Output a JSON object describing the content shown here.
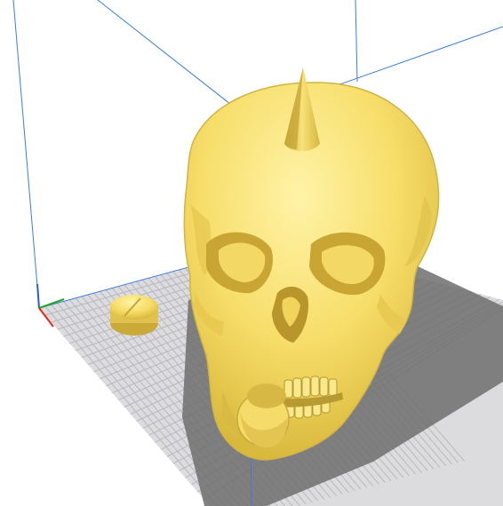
{
  "viewport": {
    "scene": "3d-build-volume-viewport",
    "background": "#ffffff",
    "grid_plate_color": "#dcdcde",
    "grid_line_color": "#b8b8be",
    "build_volume_edge_color": "#3b7fd6",
    "model_color": "#f7de6a",
    "model_shadow_color": "#7a7a7a"
  },
  "axes": {
    "x_color": "#e0281d",
    "y_color": "#2aa42a",
    "z_color": "#2a5bd7"
  },
  "objects": {
    "main_model": "skull-model",
    "spike": "spike-model",
    "small_part_left": "disc-part-model",
    "jaw_plug": "cylinder-plug-model"
  }
}
